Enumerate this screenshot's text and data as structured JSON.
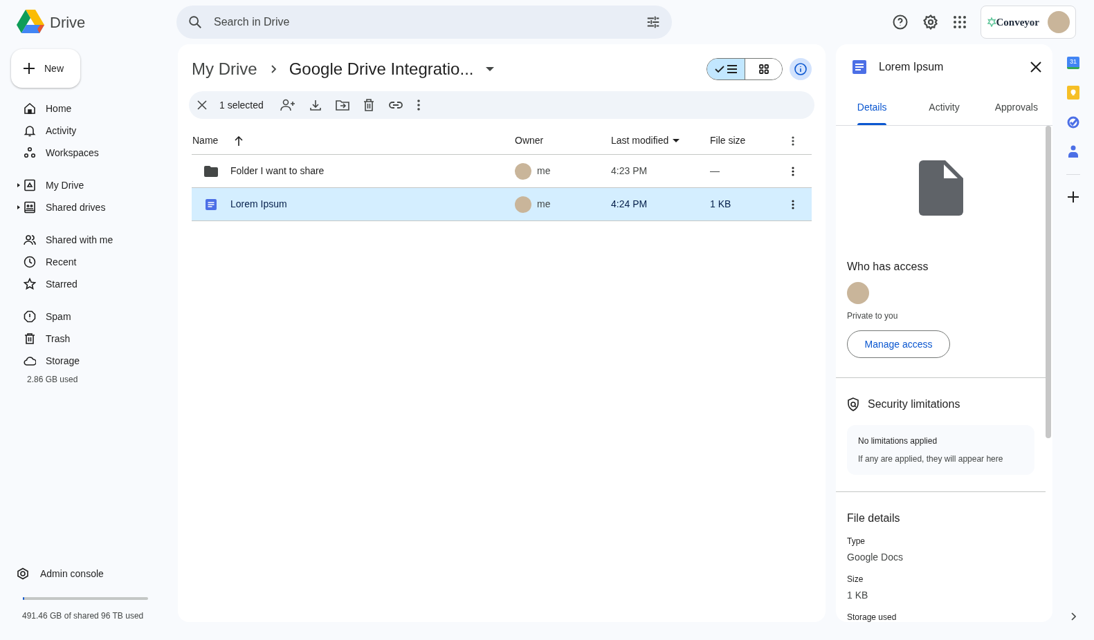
{
  "app": {
    "name": "Drive"
  },
  "search": {
    "placeholder": "Search in Drive"
  },
  "account": {
    "org_name": "Conveyor"
  },
  "new_button": {
    "label": "New"
  },
  "sidebar": {
    "groups": [
      {
        "items": [
          {
            "label": "Home",
            "selected": false
          },
          {
            "label": "Activity",
            "selected": false
          },
          {
            "label": "Workspaces",
            "selected": false
          }
        ]
      },
      {
        "items": [
          {
            "label": "My Drive",
            "selected": false,
            "expanded": false
          },
          {
            "label": "Shared drives",
            "selected": false,
            "expanded": false
          }
        ]
      },
      {
        "items": [
          {
            "label": "Shared with me",
            "selected": false
          },
          {
            "label": "Recent",
            "selected": false
          },
          {
            "label": "Starred",
            "selected": false
          }
        ]
      },
      {
        "items": [
          {
            "label": "Spam",
            "selected": false
          },
          {
            "label": "Trash",
            "selected": false
          },
          {
            "label": "Storage",
            "selected": false
          }
        ]
      }
    ],
    "storage_used": "2.86 GB used",
    "admin": {
      "label": "Admin console"
    },
    "quota": {
      "level": 0.005,
      "text": "491.46 GB of shared 96 TB used"
    }
  },
  "breadcrumb": [
    "My Drive",
    "Google Drive Integratio..."
  ],
  "view_toggle": [
    {
      "kind": "list",
      "selected": true
    },
    {
      "kind": "grid",
      "selected": false
    }
  ],
  "details_button": {
    "on": true
  },
  "selection_bar": {
    "count": "1 selected"
  },
  "table": {
    "columns": [
      {
        "label": "Name",
        "sorted": true,
        "descending": false
      },
      {
        "label": "Owner",
        "sorted": false
      },
      {
        "label": "Last modified",
        "sorted": true,
        "descending": true
      },
      {
        "label": "File size",
        "sorted": false
      }
    ],
    "rows": [
      {
        "kind": "folder",
        "name": "Folder I want to share",
        "owner": "me",
        "modified": "4:23 PM",
        "size": "—",
        "selected": false
      },
      {
        "kind": "doc",
        "name": "Lorem Ipsum",
        "owner": "me",
        "modified": "4:24 PM",
        "size": "1 KB",
        "selected": true
      }
    ]
  },
  "details": {
    "title": "Lorem Ipsum",
    "tabs": [
      {
        "label": "Details",
        "selected": true
      },
      {
        "label": "Activity",
        "selected": false
      },
      {
        "label": "Approvals",
        "selected": false
      }
    ],
    "access": {
      "heading": "Who has access",
      "note": "Private to you",
      "button": "Manage access"
    },
    "security": {
      "heading": "Security limitations",
      "title": "No limitations applied",
      "text": "If any are applied, they will appear here"
    },
    "file_details": {
      "heading": "File details",
      "fields": [
        {
          "label": "Type",
          "value": "Google Docs"
        },
        {
          "label": "Size",
          "value": "1 KB"
        },
        {
          "label": "Storage used"
        }
      ]
    }
  },
  "side_rail": {
    "calendar_day": "31"
  }
}
